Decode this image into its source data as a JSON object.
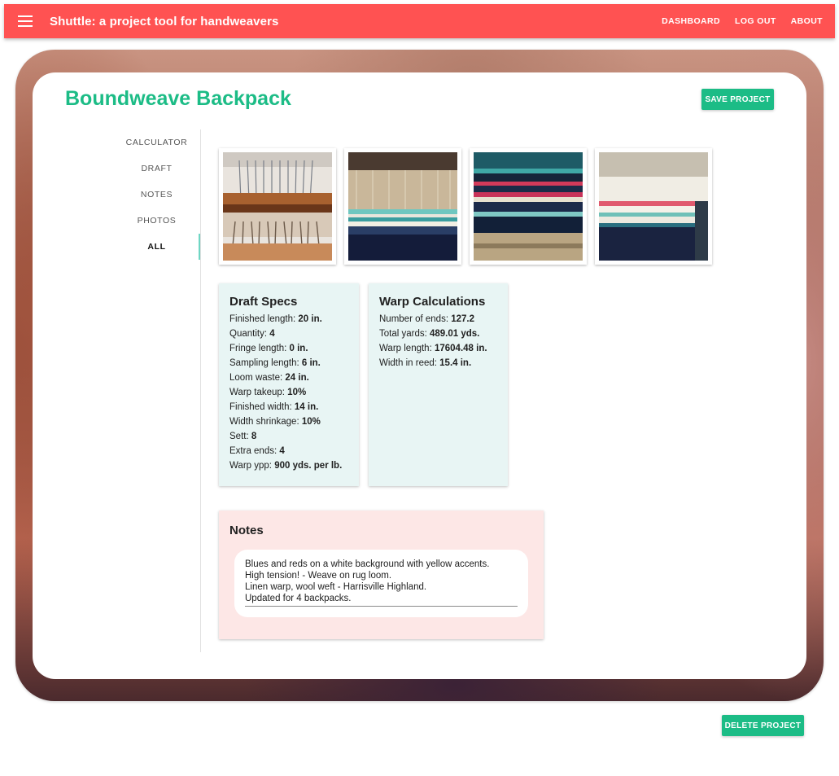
{
  "appbar": {
    "title": "Shuttle: a project tool for handweavers",
    "menu_icon": "hamburger-menu-icon",
    "nav": [
      "DASHBOARD",
      "LOG OUT",
      "ABOUT"
    ],
    "color": "#ff5252"
  },
  "project": {
    "title": "Boundweave Backpack",
    "save_label": "SAVE PROJECT",
    "delete_label": "DELETE PROJECT",
    "accent_color": "#1cbc86"
  },
  "tabs": [
    {
      "label": "CALCULATOR",
      "active": false
    },
    {
      "label": "DRAFT",
      "active": false
    },
    {
      "label": "NOTES",
      "active": false
    },
    {
      "label": "PHOTOS",
      "active": false
    },
    {
      "label": "ALL",
      "active": true
    }
  ],
  "photos": [
    {
      "subject": "loom-warp-threads"
    },
    {
      "subject": "woven-blue-stripes"
    },
    {
      "subject": "colorful-striped-weaving"
    },
    {
      "subject": "weaving-on-loom-white-blue"
    }
  ],
  "draft_specs": {
    "title": "Draft Specs",
    "rows": [
      {
        "label": "Finished length: ",
        "value": "20 in."
      },
      {
        "label": "Quantity: ",
        "value": "4"
      },
      {
        "label": "Fringe length: ",
        "value": "0 in."
      },
      {
        "label": "Sampling length: ",
        "value": "6 in."
      },
      {
        "label": "Loom waste: ",
        "value": "24 in."
      },
      {
        "label": "Warp takeup: ",
        "value": "10%"
      },
      {
        "label": "Finished width: ",
        "value": "14 in."
      },
      {
        "label": "Width shrinkage: ",
        "value": "10%"
      },
      {
        "label": "Sett: ",
        "value": "8"
      },
      {
        "label": "Extra ends: ",
        "value": "4"
      },
      {
        "label": "Warp ypp: ",
        "value": "900 yds. per lb."
      }
    ]
  },
  "warp_calculations": {
    "title": "Warp Calculations",
    "rows": [
      {
        "label": "Number of ends: ",
        "value": "127.2"
      },
      {
        "label": "Total yards: ",
        "value": "489.01 yds."
      },
      {
        "label": "Warp length: ",
        "value": "17604.48 in."
      },
      {
        "label": "Width in reed: ",
        "value": "15.4 in."
      }
    ]
  },
  "notes": {
    "title": "Notes",
    "text": "Blues and reds on a white background with yellow accents.\nHigh tension! - Weave on rug loom.\nLinen warp, wool weft - Harrisville Highland.\nUpdated for 4 backpacks."
  }
}
